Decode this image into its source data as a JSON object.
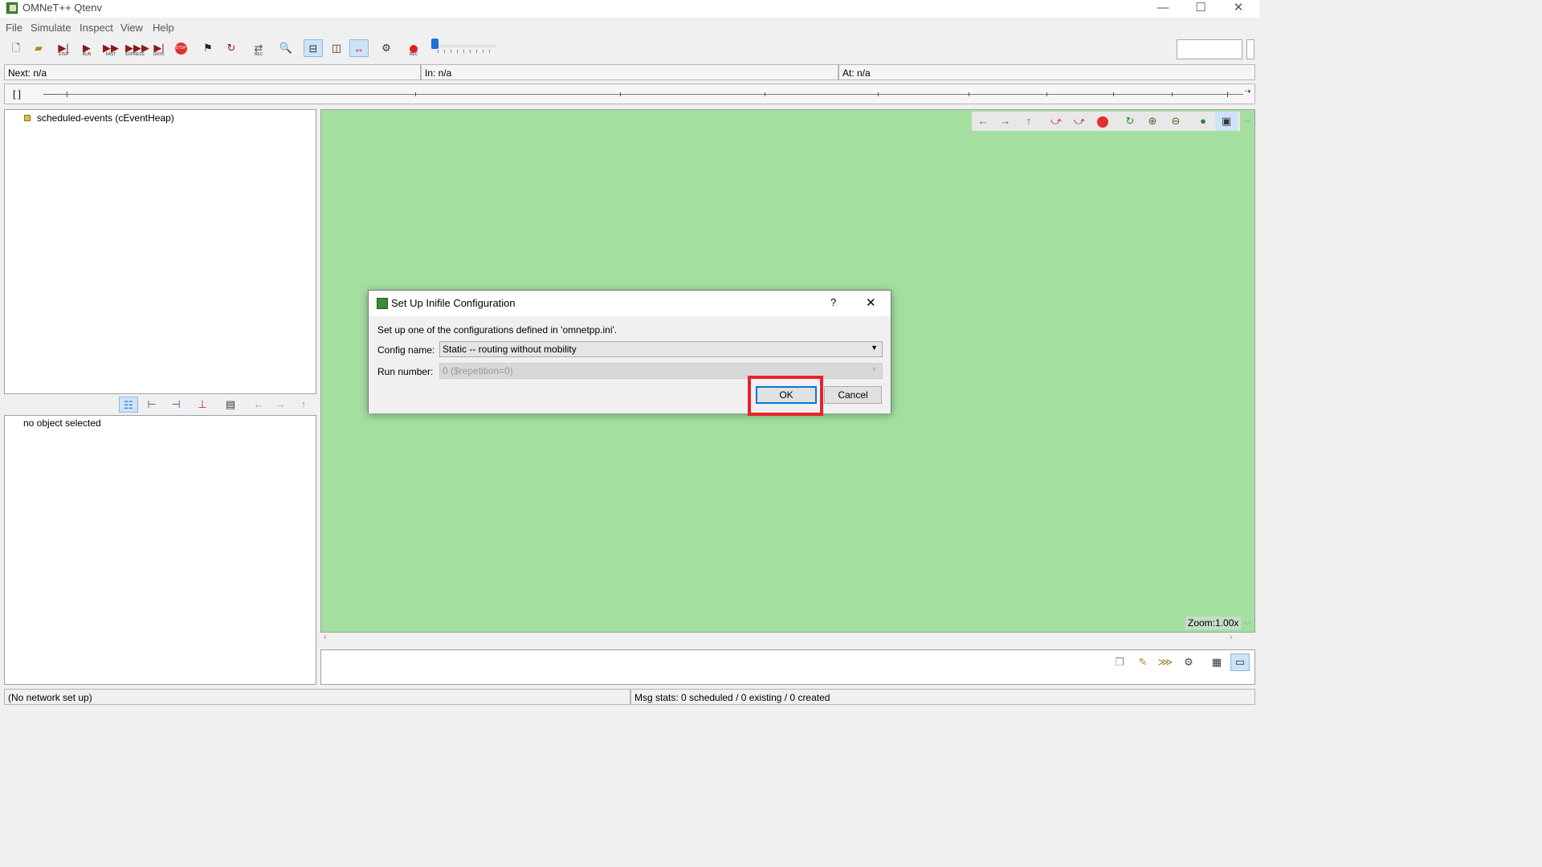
{
  "window": {
    "title": "OMNeT++ Qtenv",
    "controls": [
      "—",
      "☐",
      "✕"
    ]
  },
  "menu": [
    "File",
    "Simulate",
    "Inspect",
    "View",
    "Help"
  ],
  "toolbar": {
    "step": "STEP",
    "run": "RUN",
    "fast": "FAST",
    "express": "EXPRESS",
    "until": "UNTIL",
    "stop": "STOP",
    "rec": "REC"
  },
  "status_strip": {
    "next": "Next: n/a",
    "in": "In: n/a",
    "at": "At: n/a"
  },
  "timeline": {
    "brackets": "[   ]"
  },
  "object_tree": {
    "root_item": "scheduled-events (cEventHeap)"
  },
  "object_inspector": {
    "empty_text": "no object selected"
  },
  "canvas": {
    "zoom": "Zoom:1.00x"
  },
  "dialog": {
    "title": "Set Up Inifile Configuration",
    "help": "?",
    "close": "✕",
    "description": "Set up one of the configurations defined in 'omnetpp.ini'.",
    "config_label": "Config name:",
    "config_value": "Static -- routing without mobility",
    "run_label": "Run number:",
    "run_value": "0 ($repetition=0)",
    "ok": "OK",
    "cancel": "Cancel"
  },
  "statusbar": {
    "left": "(No network set up)",
    "right": "Msg stats: 0 scheduled / 0 existing / 0 created"
  },
  "colors": {
    "canvas_bg": "#a3e0a0",
    "highlight": "#e8232a",
    "accent_blue": "#1e6fd9"
  }
}
